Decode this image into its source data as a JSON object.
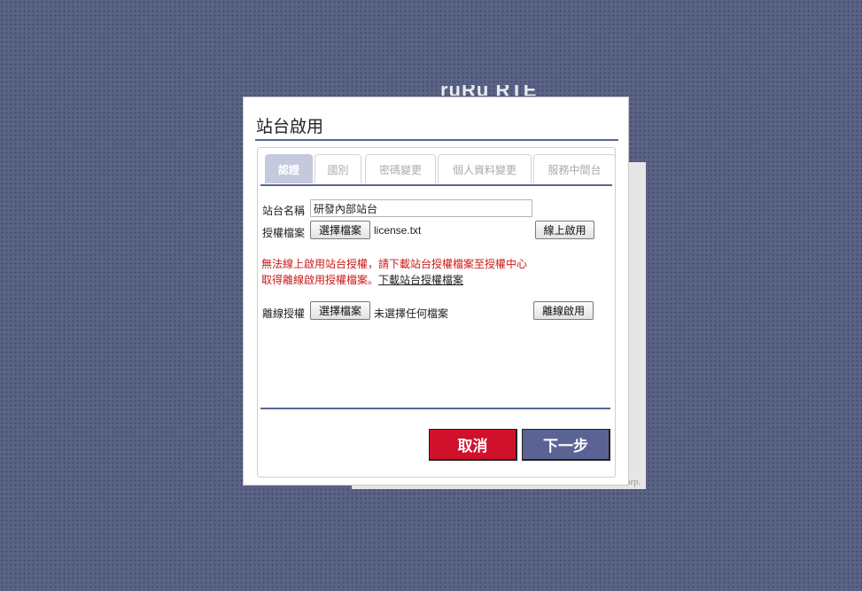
{
  "background": {
    "logo_text": "ruRu RTE",
    "footer_text": "orp."
  },
  "dialog": {
    "title": "站台啟用",
    "tabs": [
      {
        "label": "認證",
        "active": true
      },
      {
        "label": "國別",
        "active": false
      },
      {
        "label": "密碼變更",
        "active": false
      },
      {
        "label": "個人資料變更",
        "active": false
      },
      {
        "label": "服務中間台",
        "active": false
      }
    ],
    "site_name": {
      "label": "站台名稱",
      "value": "研發內部站台"
    },
    "license_file": {
      "label": "授權檔案",
      "choose_label": "選擇檔案",
      "file_name": "license.txt",
      "activate_label": "線上啟用"
    },
    "warning": {
      "text": "無法線上啟用站台授權，請下載站台授權檔案至授權中心取得離線啟用授權檔案。",
      "link_text": "下載站台授權檔案"
    },
    "offline": {
      "label": "離線授權",
      "choose_label": "選擇檔案",
      "file_name": "未選擇任何檔案",
      "activate_label": "離線啟用"
    },
    "buttons": {
      "cancel": "取消",
      "next": "下一步"
    },
    "colors": {
      "accent": "#5c6496",
      "cancel": "#d0112b",
      "next": "#5b6395",
      "warning": "#cc1a1a"
    }
  }
}
